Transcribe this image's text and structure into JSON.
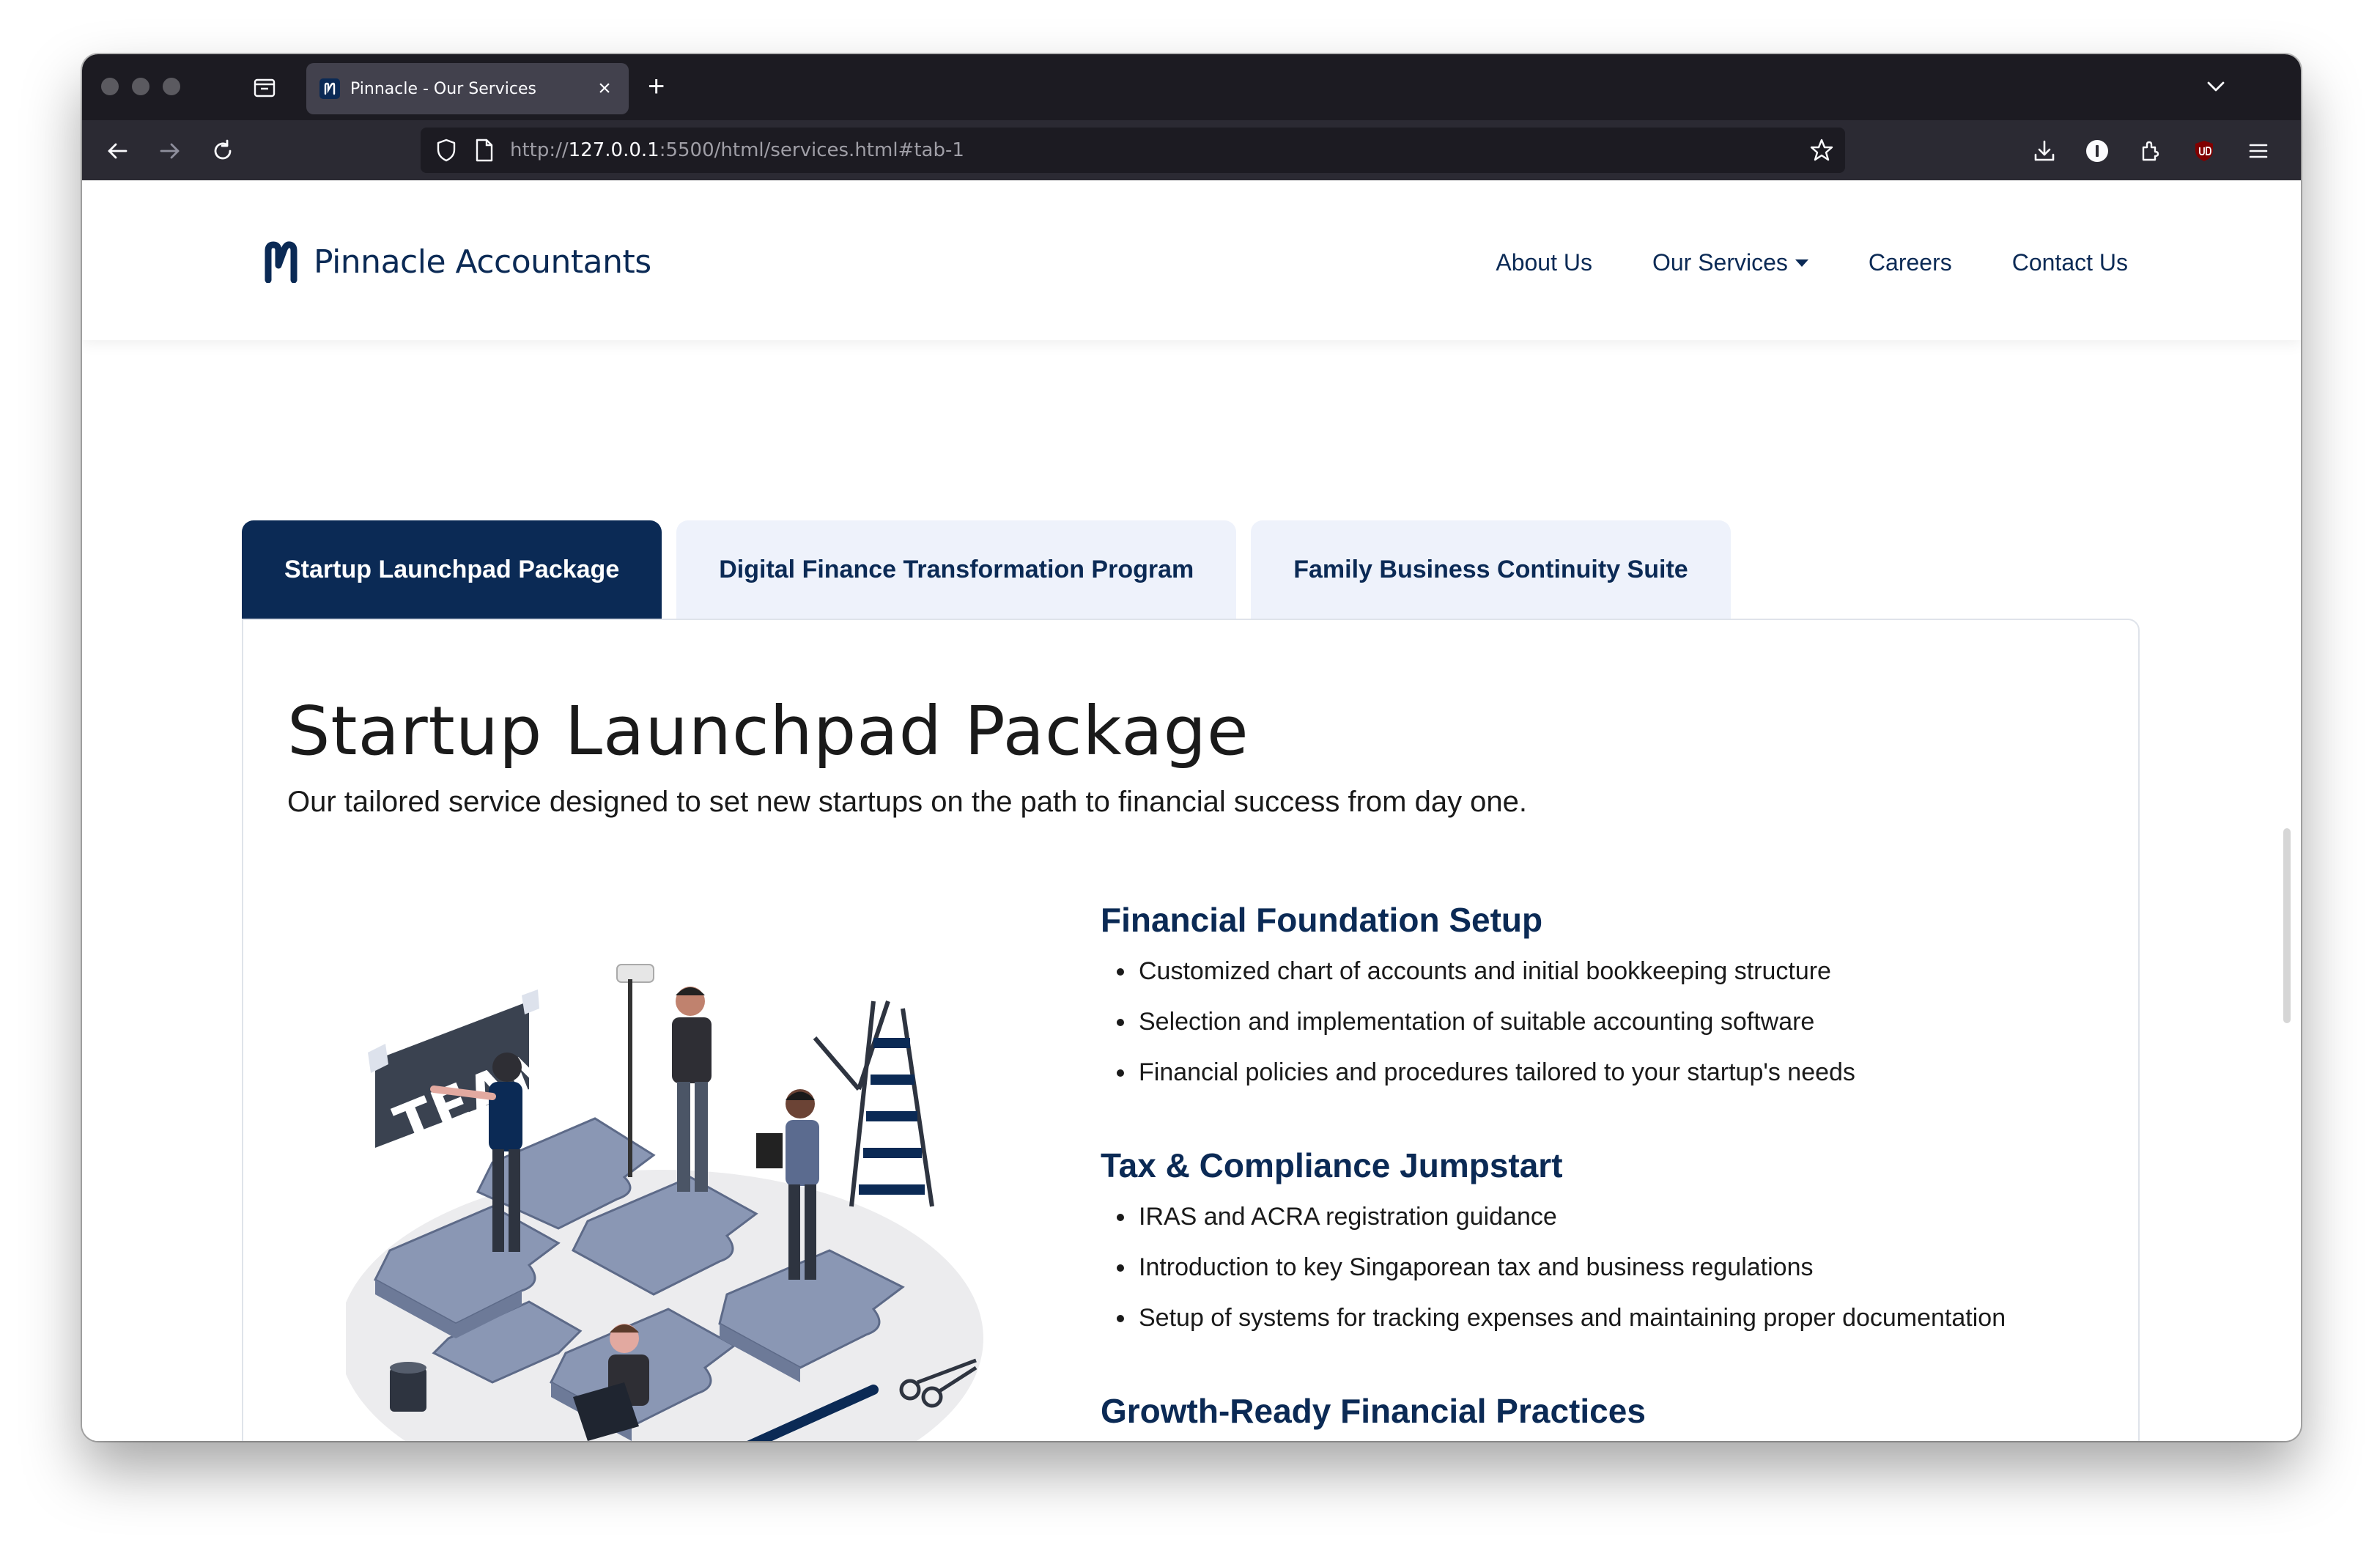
{
  "browser": {
    "tab_title": "Pinnacle - Our Services",
    "url_scheme": "http://",
    "url_host": "127.0.0.1",
    "url_rest": ":5500/html/services.html#tab-1"
  },
  "site": {
    "brand": "Pinnacle Accountants",
    "nav": {
      "about": "About Us",
      "services": "Our Services",
      "careers": "Careers",
      "contact": "Contact Us"
    },
    "accent_color": "#0b2a55"
  },
  "service_tabs": [
    {
      "label": "Startup Launchpad Package",
      "active": true
    },
    {
      "label": "Digital Finance Transformation Program",
      "active": false
    },
    {
      "label": "Family Business Continuity Suite",
      "active": false
    }
  ],
  "panel": {
    "title": "Startup Launchpad Package",
    "subtitle": "Our tailored service designed to set new startups on the path to financial success from day one.",
    "illustration_text": "TEAM",
    "features": [
      {
        "heading": "Financial Foundation Setup",
        "items": [
          "Customized chart of accounts and initial bookkeeping structure",
          "Selection and implementation of suitable accounting software",
          "Financial policies and procedures tailored to your startup's needs"
        ]
      },
      {
        "heading": "Tax & Compliance Jumpstart",
        "items": [
          "IRAS and ACRA registration guidance",
          "Introduction to key Singaporean tax and business regulations",
          "Setup of systems for tracking expenses and maintaining proper documentation"
        ]
      },
      {
        "heading": "Growth-Ready Financial Practices",
        "items": []
      }
    ]
  }
}
